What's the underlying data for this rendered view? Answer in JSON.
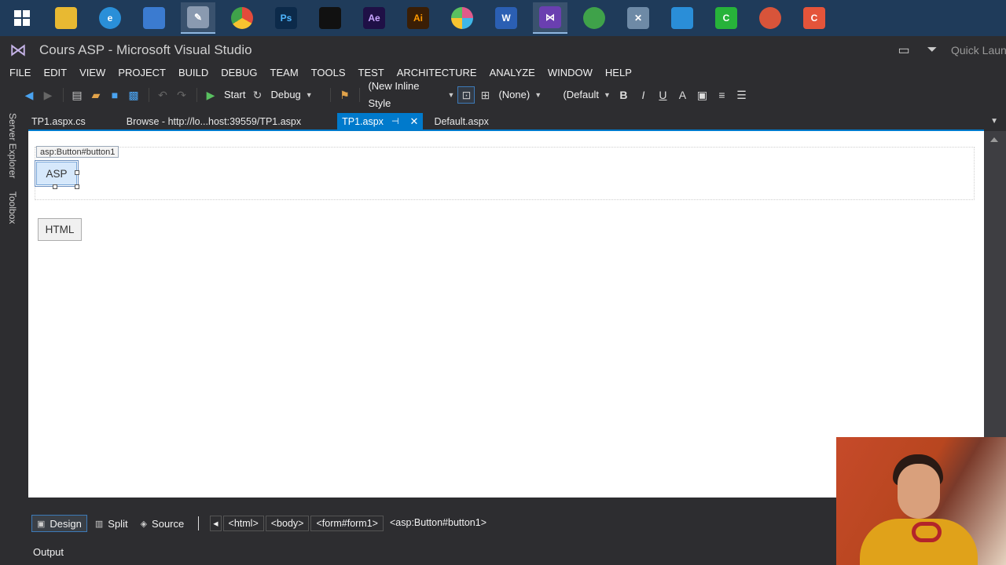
{
  "taskbar": {
    "apps": [
      {
        "name": "windows-start",
        "label": "",
        "color": "#1f3b5a"
      },
      {
        "name": "file-explorer",
        "label": "",
        "color": "#e8b932"
      },
      {
        "name": "ie",
        "label": "",
        "color": "#2a8fd8"
      },
      {
        "name": "app-window",
        "label": "",
        "color": "#3b7bd0"
      },
      {
        "name": "paint",
        "label": "",
        "color": "#8a9ab0"
      },
      {
        "name": "chrome",
        "label": "",
        "color": "#e44b3b"
      },
      {
        "name": "photoshop",
        "label": "Ps",
        "color": "#0c2a4a"
      },
      {
        "name": "media",
        "label": "",
        "color": "#111111"
      },
      {
        "name": "after-effects",
        "label": "Ae",
        "color": "#1f1046"
      },
      {
        "name": "illustrator",
        "label": "Ai",
        "color": "#3a1e05"
      },
      {
        "name": "photos",
        "label": "",
        "color": "#e05a8a"
      },
      {
        "name": "word",
        "label": "W",
        "color": "#2b5fb3"
      },
      {
        "name": "visual-studio",
        "label": "",
        "color": "#6a3fb0"
      },
      {
        "name": "android-studio",
        "label": "",
        "color": "#3fa24a"
      },
      {
        "name": "tools",
        "label": "",
        "color": "#6e8aa6"
      },
      {
        "name": "remote",
        "label": "",
        "color": "#2a8ed8"
      },
      {
        "name": "camtasia",
        "label": "C",
        "color": "#27b33a"
      },
      {
        "name": "chrome-dev",
        "label": "",
        "color": "#d8543a"
      },
      {
        "name": "camtasia-recorder",
        "label": "C",
        "color": "#e4543a"
      }
    ]
  },
  "window": {
    "title": "Cours ASP - Microsoft Visual Studio",
    "quick_launch": "Quick Laun"
  },
  "menu": [
    "FILE",
    "EDIT",
    "VIEW",
    "PROJECT",
    "BUILD",
    "DEBUG",
    "TEAM",
    "TOOLS",
    "TEST",
    "ARCHITECTURE",
    "ANALYZE",
    "WINDOW",
    "HELP"
  ],
  "toolbar": {
    "start_label": "Start",
    "config_value": "Debug",
    "style_value": "(New Inline Style",
    "none_value": "(None)",
    "default_value": "(Default",
    "bold": "B",
    "italic": "I",
    "underline": "U"
  },
  "side_tabs": [
    "Server Explorer",
    "Toolbox"
  ],
  "doc_tabs": [
    {
      "label": "TP1.aspx.cs",
      "active": false
    },
    {
      "label": "Browse - http://lo...host:39559/TP1.aspx",
      "active": false
    },
    {
      "label": "TP1.aspx",
      "active": true
    },
    {
      "label": "Default.aspx",
      "active": false
    }
  ],
  "design": {
    "control_tag": "asp:Button#button1",
    "asp_button": "ASP",
    "html_button": "HTML"
  },
  "viewbar": {
    "design": "Design",
    "split": "Split",
    "source": "Source",
    "crumbs": [
      "<html>",
      "<body>",
      "<form#form1>",
      "<asp:Button#button1>"
    ]
  },
  "output_label": "Output"
}
